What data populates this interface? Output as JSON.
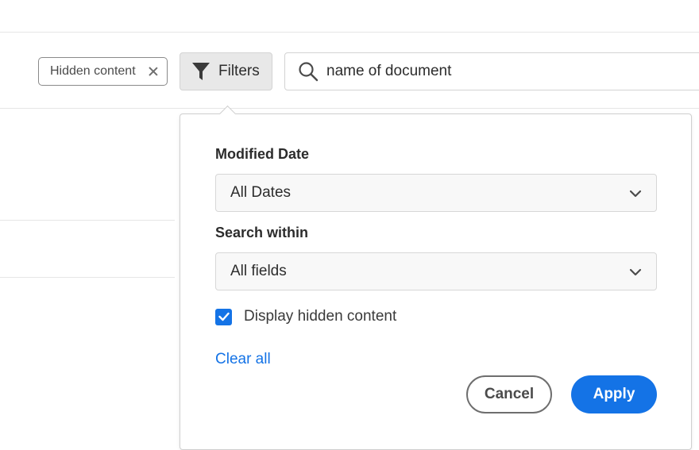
{
  "toolbar": {
    "chip_label": "Hidden content",
    "filters_label": "Filters",
    "search_value": "name of document"
  },
  "filters_panel": {
    "modified_date_label": "Modified Date",
    "modified_date_value": "All Dates",
    "search_within_label": "Search within",
    "search_within_value": "All fields",
    "display_hidden_label": "Display hidden content",
    "display_hidden_checked": true,
    "clear_all_label": "Clear all",
    "cancel_label": "Cancel",
    "apply_label": "Apply"
  },
  "colors": {
    "accent": "#1473e6",
    "filters_button_bg": "#e8e8e8",
    "text": "#2c2c2c"
  },
  "icons": [
    "close-icon",
    "filter-funnel-icon",
    "search-icon",
    "chevron-down-icon",
    "checkmark-icon"
  ]
}
